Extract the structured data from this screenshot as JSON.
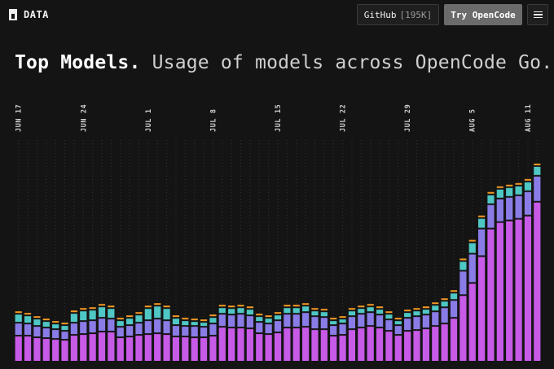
{
  "header": {
    "brand": "DATA",
    "logo_icon": "square-logo-icon",
    "github_label": "GitHub",
    "github_count": "[195K]",
    "try_label": "Try OpenCode",
    "menu_icon": "hamburger-menu-icon"
  },
  "headline": {
    "strong": "Top Models.",
    "light": "Usage of models across OpenCode Go."
  },
  "chart_data": {
    "type": "bar",
    "stacked": true,
    "grid": "vertical-dotted",
    "x_tick_labels": [
      {
        "index": 0,
        "label": "JUN 17"
      },
      {
        "index": 7,
        "label": "JUN 24"
      },
      {
        "index": 14,
        "label": "JUL 1"
      },
      {
        "index": 21,
        "label": "JUL 8"
      },
      {
        "index": 28,
        "label": "JUL 15"
      },
      {
        "index": 35,
        "label": "JUL 22"
      },
      {
        "index": 42,
        "label": "JUL 29"
      },
      {
        "index": 49,
        "label": "AUG 5"
      },
      {
        "index": 55,
        "label": "AUG 11"
      }
    ],
    "colors": [
      "#c85ae8",
      "#8a7ce6",
      "#4fc7c4",
      "#f59a23"
    ],
    "series": [
      {
        "values": [
          30,
          30,
          28,
          27,
          26,
          25,
          31,
          32,
          33,
          35,
          35,
          28,
          29,
          31,
          32,
          33,
          32,
          29,
          29,
          28,
          28,
          30,
          41,
          40,
          40,
          39,
          33,
          32,
          34,
          40,
          40,
          41,
          38,
          38,
          30,
          31,
          38,
          40,
          42,
          40,
          36,
          31,
          36,
          37,
          39,
          42,
          45,
          52,
          80,
          95,
          128,
          162,
          170,
          172,
          174,
          178,
          195
        ]
      },
      {
        "values": [
          14,
          13,
          12,
          11,
          10,
          9,
          13,
          14,
          14,
          15,
          14,
          11,
          12,
          13,
          15,
          16,
          15,
          12,
          11,
          12,
          11,
          13,
          14,
          14,
          15,
          14,
          12,
          11,
          13,
          15,
          15,
          16,
          14,
          13,
          11,
          12,
          14,
          15,
          15,
          14,
          12,
          10,
          14,
          15,
          15,
          16,
          18,
          20,
          28,
          34,
          32,
          28,
          27,
          27,
          27,
          28,
          30
        ]
      },
      {
        "values": [
          9,
          8,
          7,
          6,
          5,
          5,
          10,
          11,
          11,
          12,
          11,
          6,
          7,
          8,
          13,
          14,
          13,
          7,
          5,
          4,
          4,
          6,
          6,
          6,
          6,
          6,
          5,
          5,
          5,
          6,
          6,
          6,
          5,
          5,
          4,
          4,
          5,
          5,
          5,
          5,
          5,
          4,
          5,
          5,
          5,
          6,
          6,
          7,
          10,
          12,
          11,
          10,
          10,
          10,
          10,
          10,
          10
        ]
      },
      {
        "values": [
          2,
          2,
          2,
          2,
          2,
          2,
          2,
          2,
          2,
          2,
          2,
          2,
          2,
          2,
          2,
          2,
          2,
          2,
          2,
          2,
          2,
          2,
          2,
          2,
          2,
          2,
          2,
          2,
          2,
          2,
          2,
          2,
          2,
          2,
          2,
          2,
          2,
          2,
          2,
          2,
          2,
          2,
          2,
          2,
          2,
          2,
          2,
          2,
          2,
          2,
          2,
          2,
          2,
          2,
          2,
          2,
          2
        ]
      }
    ],
    "ylim": [
      0,
      272
    ]
  }
}
